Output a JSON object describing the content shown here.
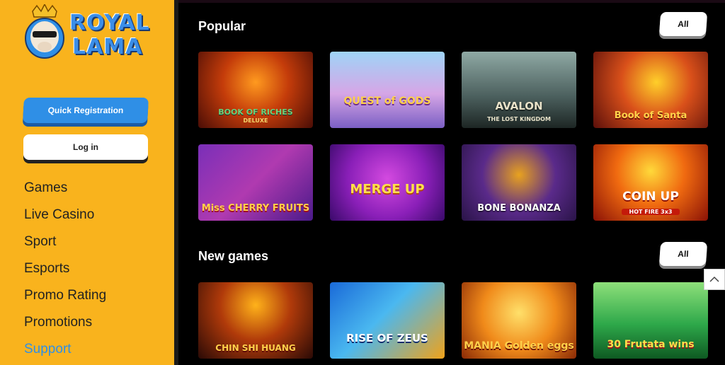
{
  "brand": {
    "line1": "ROYAL",
    "line2": "LAMA"
  },
  "buttons": {
    "register": "Quick Registration",
    "login": "Log in"
  },
  "nav": [
    {
      "label": "Games"
    },
    {
      "label": "Live Casino"
    },
    {
      "label": "Sport"
    },
    {
      "label": "Esports"
    },
    {
      "label": "Promo Rating"
    },
    {
      "label": "Promotions"
    },
    {
      "label": "Support",
      "active": true
    }
  ],
  "sections": {
    "popular": {
      "title": "Popular",
      "all": "All",
      "games": [
        {
          "title": "BOOK OF RICHES",
          "sub": "DELUXE"
        },
        {
          "title": "QUEST of GODS",
          "sub": ""
        },
        {
          "title": "AVALON",
          "sub": "THE LOST KINGDOM"
        },
        {
          "title": "Book of Santa",
          "sub": ""
        },
        {
          "title": "Miss CHERRY FRUITS",
          "sub": ""
        },
        {
          "title": "MERGE UP",
          "sub": ""
        },
        {
          "title": "BONE BONANZA",
          "sub": ""
        },
        {
          "title": "COIN UP",
          "sub": "HOT FIRE 3x3"
        }
      ]
    },
    "new": {
      "title": "New games",
      "all": "All",
      "games": [
        {
          "title": "CHIN SHI HUANG",
          "sub": ""
        },
        {
          "title": "RISE OF ZEUS",
          "sub": ""
        },
        {
          "title": "MANIA Golden eggs",
          "sub": ""
        },
        {
          "title": "30 Frutata wins",
          "sub": ""
        }
      ]
    }
  },
  "colors": {
    "sidebar": "#f9b31d",
    "accent": "#2f8fe6"
  },
  "icons": {
    "scroll_top": "chevron-up-icon",
    "mascot": "lama-mascot-icon"
  }
}
